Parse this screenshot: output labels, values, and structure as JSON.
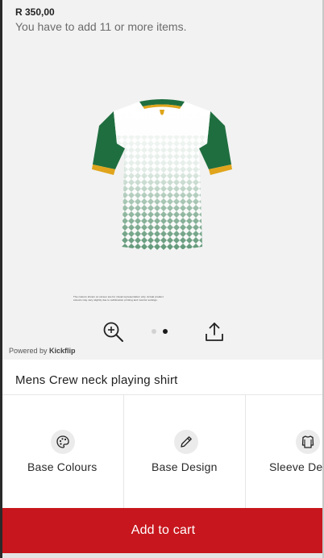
{
  "pricing": {
    "price": "R 350,00",
    "minimum_note": "You have to add 11 or more items."
  },
  "viewer": {
    "fine_print": "The colours shown on screen are for visual representation only. Actual product colours may vary slightly due to sublimation printing and monitor settings.",
    "zoom_icon": "zoom-in-icon",
    "share_icon": "share-upload-icon",
    "pager": {
      "total": 2,
      "active": 2
    },
    "powered_prefix": "Powered by",
    "powered_brand": "Kickflip"
  },
  "product": {
    "title": "Mens Crew neck playing shirt"
  },
  "options": [
    {
      "label": "Base Colours",
      "icon": "palette-icon"
    },
    {
      "label": "Base Design",
      "icon": "pencil-icon"
    },
    {
      "label": "Sleeve Det",
      "icon": "shirt-icon"
    }
  ],
  "cart": {
    "label": "Add to cart",
    "color": "#c7161d"
  },
  "colors": {
    "jersey_green": "#1f6e3f",
    "jersey_gold": "#e0a51c",
    "jersey_white": "#f7f7f7",
    "viewer_bg": "#f2f2f2"
  }
}
